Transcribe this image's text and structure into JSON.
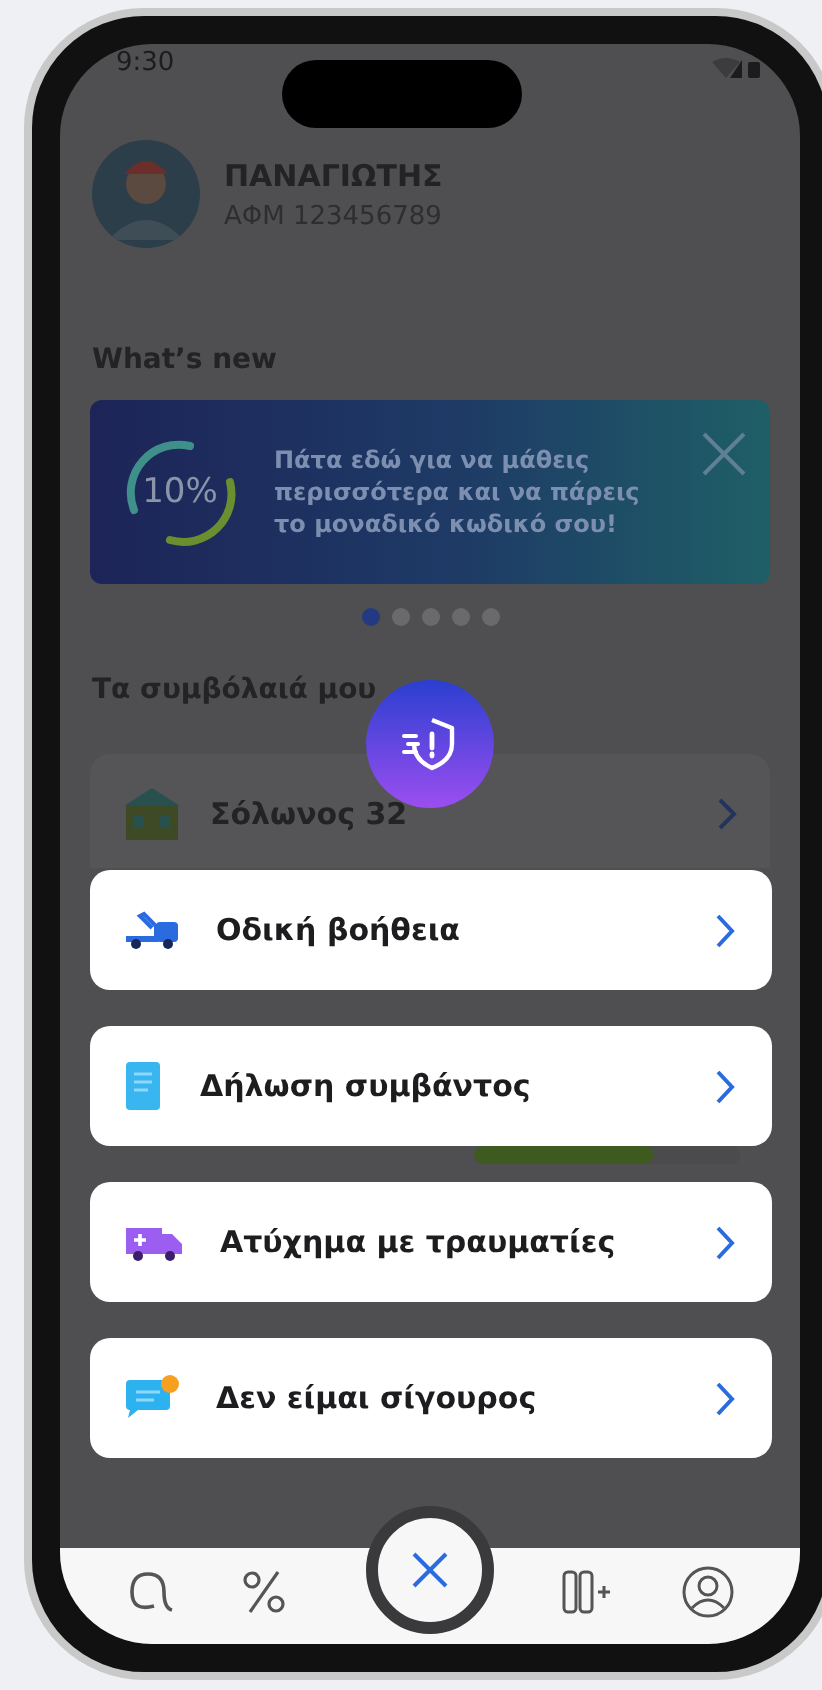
{
  "status_bar": {
    "time": "9:30"
  },
  "profile": {
    "name": "ΠΑΝΑΓΙΩΤΗΣ",
    "tax_id": "ΑΦΜ 123456789"
  },
  "whats_new": {
    "title": "What’s new",
    "banner": {
      "value": "10%",
      "text": "Πάτα εδώ για να μάθεις περισσότερα και να πάρεις το μοναδικό κωδικό σου!"
    },
    "pages": [
      {
        "selected": true
      },
      {
        "selected": false
      },
      {
        "selected": false
      },
      {
        "selected": false
      },
      {
        "selected": false
      }
    ]
  },
  "contracts": {
    "title": "Τα συμβόλαιά μου",
    "items": [
      {
        "name": "Σόλωνος 32",
        "level": 0.68
      }
    ]
  },
  "actions": [
    {
      "kind": "tow",
      "label": "Οδική βοήθεια"
    },
    {
      "kind": "report",
      "label": "Δήλωση συμβάντος"
    },
    {
      "kind": "ambulance",
      "label": "Ατύχημα με τραυματίες"
    },
    {
      "kind": "unsure",
      "label": "Δεν είμαι σίγουρος"
    }
  ]
}
